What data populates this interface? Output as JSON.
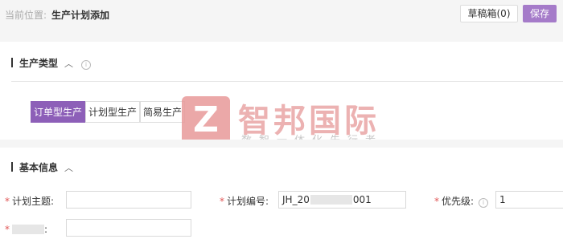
{
  "header": {
    "breadcrumb_label": "当前位置:",
    "breadcrumb_current": "生产计划添加",
    "draft_button": "草稿箱(0)",
    "save_button": "保存"
  },
  "production_type": {
    "title": "生产类型",
    "tabs": [
      "订单型生产",
      "计划型生产",
      "简易生产"
    ],
    "active_tab": 0
  },
  "watermark": {
    "logo_letter": "Z",
    "name": "智邦国际",
    "slogan": "数智一体化先行者"
  },
  "basic_info": {
    "title": "基本信息",
    "fields": {
      "plan_subject": {
        "label": "计划主题:",
        "value": ""
      },
      "plan_number": {
        "label": "计划编号:",
        "value_prefix": "JH_20",
        "value_suffix": "001"
      },
      "priority": {
        "label": "优先级:",
        "value": "1"
      },
      "fourth": {
        "label": ":",
        "value": ""
      }
    }
  },
  "colors": {
    "accent": "#a57bc9",
    "active_tab": "#8d5fb8",
    "required": "#e05555"
  }
}
